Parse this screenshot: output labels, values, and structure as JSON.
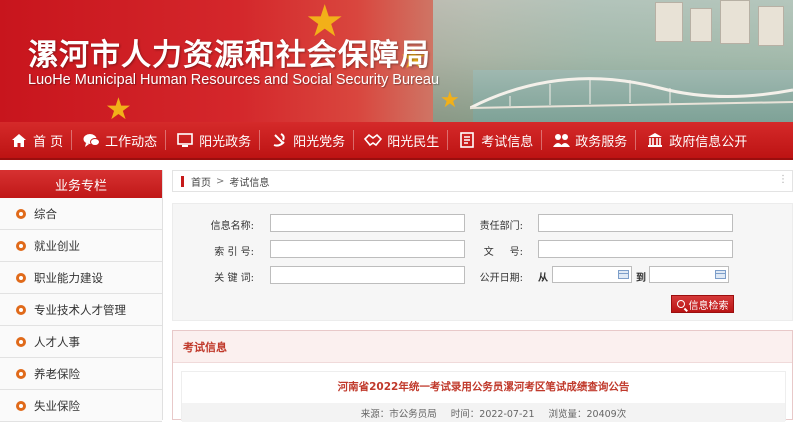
{
  "banner": {
    "title_cn": "漯河市人力资源和社会保障局",
    "title_en": "LuoHe Municipal Human Resources and Social Security Bureau"
  },
  "nav": {
    "items": [
      {
        "label": "首 页",
        "icon": "home-icon"
      },
      {
        "label": "工作动态",
        "icon": "chat-icon"
      },
      {
        "label": "阳光政务",
        "icon": "monitor-icon"
      },
      {
        "label": "阳光党务",
        "icon": "party-emblem-icon"
      },
      {
        "label": "阳光民生",
        "icon": "handshake-icon"
      },
      {
        "label": "考试信息",
        "icon": "document-icon"
      },
      {
        "label": "政务服务",
        "icon": "people-icon"
      },
      {
        "label": "政府信息公开",
        "icon": "building-icon"
      }
    ]
  },
  "sidebar": {
    "title": "业务专栏",
    "items": [
      {
        "label": "综合"
      },
      {
        "label": "就业创业"
      },
      {
        "label": "职业能力建设"
      },
      {
        "label": "专业技术人才管理"
      },
      {
        "label": "人才人事"
      },
      {
        "label": "养老保险"
      },
      {
        "label": "失业保险"
      }
    ]
  },
  "breadcrumb": {
    "home": "首页",
    "separator": ">",
    "current": "考试信息"
  },
  "search": {
    "info_name_label": "信息名称:",
    "dept_label": "责任部门:",
    "index_label": "索 引 号:",
    "doc_no_label": "文     号:",
    "keyword_label": "关 键 词:",
    "date_label": "公开日期:",
    "from_label": "从",
    "to_label": "到",
    "button_label": "信息检索",
    "info_name_value": "",
    "dept_value": "",
    "index_value": "",
    "doc_no_value": "",
    "keyword_value": ""
  },
  "exam": {
    "section_title": "考试信息",
    "article_title": "河南省2022年统一考试录用公务员漯河考区笔试成绩查询公告",
    "source": "来源：市公务员局",
    "time": "时间：2022-07-21",
    "views": "浏览量：20409次"
  },
  "colors": {
    "brand_red": "#c61a1a",
    "accent_orange": "#e06a1a"
  }
}
